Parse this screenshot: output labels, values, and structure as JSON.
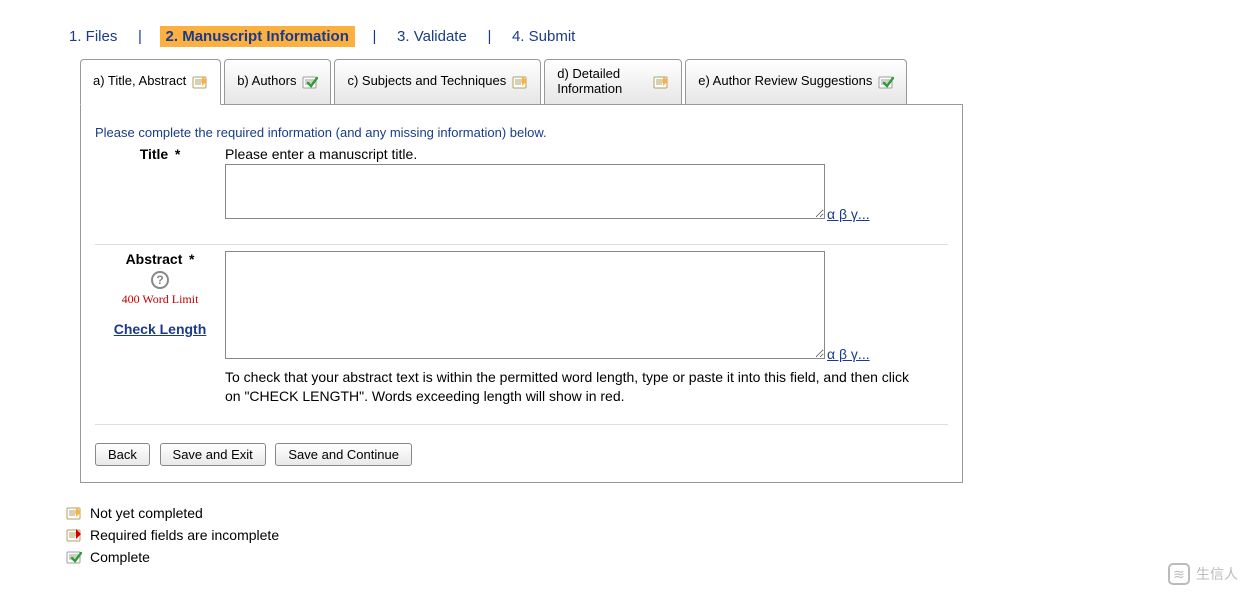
{
  "steps": {
    "s1": "1. Files",
    "s2": "2. Manuscript Information",
    "s3": "3. Validate",
    "s4": "4. Submit"
  },
  "tabs": {
    "a": "a) Title, Abstract",
    "b": "b) Authors",
    "c": "c) Subjects and Techniques",
    "d": "d) Detailed Information",
    "e": "e) Author Review Suggestions"
  },
  "instruction": "Please complete the required information (and any missing information) below.",
  "title": {
    "label": "Title",
    "star": "*",
    "hint": "Please enter a manuscript title.",
    "value": ""
  },
  "greek_link": "α β γ...",
  "abstract": {
    "label": "Abstract",
    "star": "*",
    "word_limit": "400 Word Limit",
    "check_length": "Check Length",
    "value": "",
    "note": "To check that your abstract text is within the permitted word length, type or paste it into this field, and then click on \"CHECK LENGTH\". Words exceeding length will show in red."
  },
  "buttons": {
    "back": "Back",
    "save_exit": "Save and Exit",
    "save_cont": "Save and Continue"
  },
  "legend": {
    "not_yet": "Not yet completed",
    "required_incomplete": "Required fields are incomplete",
    "complete": "Complete"
  },
  "watermark": "生信人"
}
